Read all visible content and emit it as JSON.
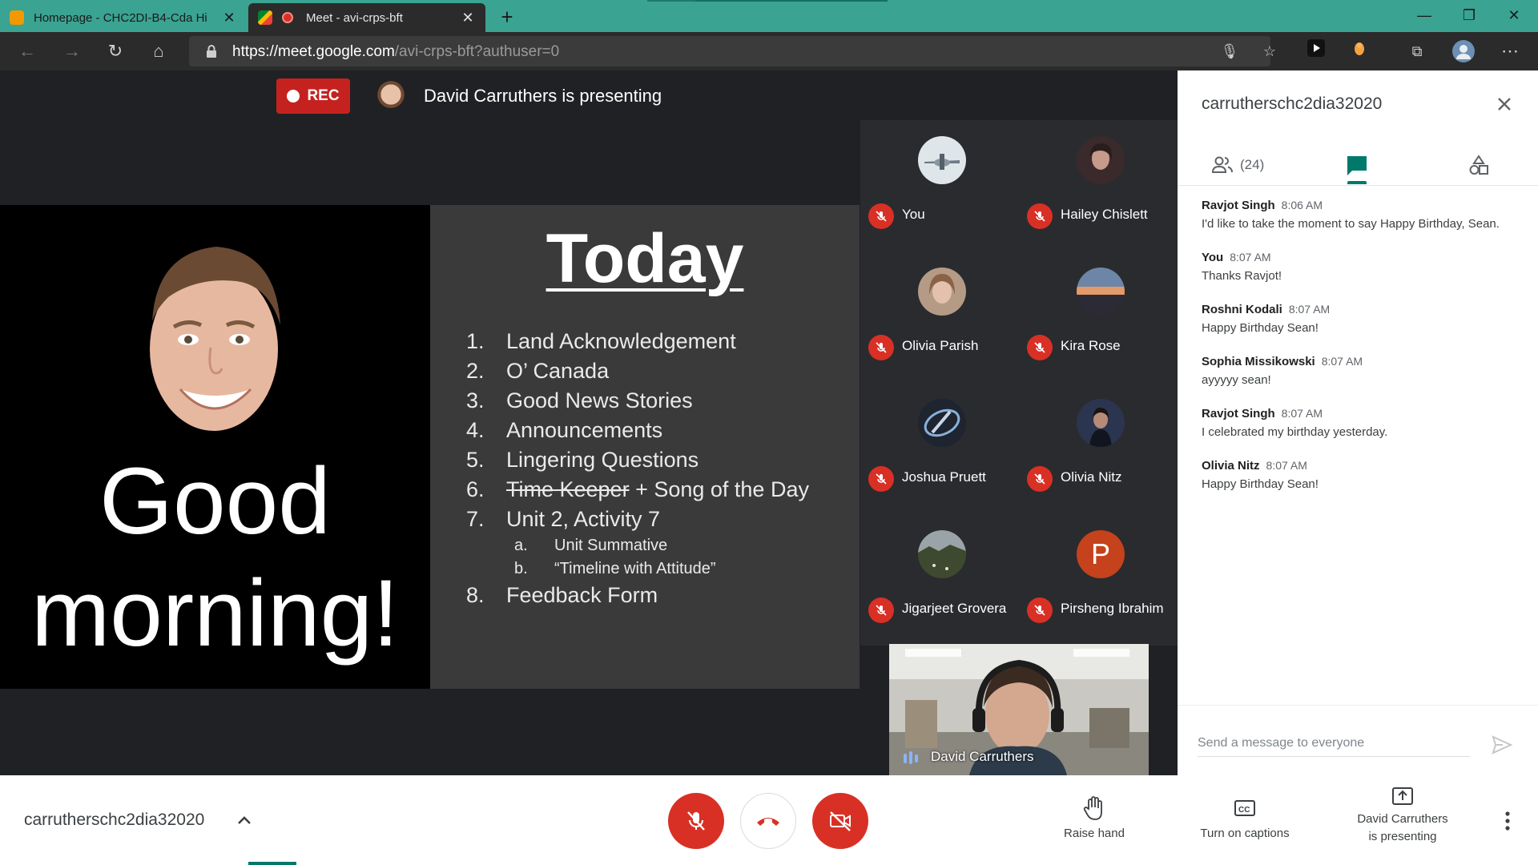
{
  "browser": {
    "tabs": [
      {
        "title": "Homepage - CHC2DI-B4-Cda Hi",
        "active": false
      },
      {
        "title": "Meet - avi-crps-bft",
        "active": true
      }
    ],
    "url_host": "https://meet.google.com",
    "url_path": "/avi-crps-bft?authuser=0"
  },
  "stage": {
    "rec_label": "REC",
    "presenting_text": "David Carruthers is presenting"
  },
  "slide": {
    "left_text": "Good morning!",
    "title": "Today",
    "agenda": [
      {
        "num": "1.",
        "text": "Land Acknowledgement"
      },
      {
        "num": "2.",
        "text": "O’ Canada"
      },
      {
        "num": "3.",
        "text": "Good News Stories"
      },
      {
        "num": "4.",
        "text": "Announcements"
      },
      {
        "num": "5.",
        "text": "Lingering Questions"
      },
      {
        "num": "6.",
        "struck": "Time Keeper",
        "text": " + Song of the Day"
      },
      {
        "num": "7.",
        "text": "Unit 2, Activity 7"
      },
      {
        "num": "a.",
        "text": "Unit Summative",
        "sub": true
      },
      {
        "num": "b.",
        "text": "“Timeline with Attitude”",
        "sub": true
      },
      {
        "num": "8.",
        "text": "Feedback Form"
      }
    ]
  },
  "participants": [
    {
      "name": "You",
      "avatar": "plane-photo"
    },
    {
      "name": "Hailey Chislett",
      "avatar": "portrait-photo"
    },
    {
      "name": "Olivia Parish",
      "avatar": "portrait-photo"
    },
    {
      "name": "Kira Rose",
      "avatar": "sunset-photo"
    },
    {
      "name": "Joshua Pruett",
      "avatar": "logo-photo"
    },
    {
      "name": "Olivia Nitz",
      "avatar": "portrait-photo"
    },
    {
      "name": "Jigarjeet Grovera",
      "avatar": "landscape-photo"
    },
    {
      "name": "Pirsheng Ibrahim",
      "avatar": "P"
    }
  ],
  "self_view": {
    "name": "David Carruthers"
  },
  "panel": {
    "title": "carrutherschc2dia32020",
    "people_count": "(24)",
    "messages": [
      {
        "sender": "Ravjot Singh",
        "time": "8:06 AM",
        "text": "I'd like to take the moment to say Happy Birthday, Sean."
      },
      {
        "sender": "You",
        "time": "8:07 AM",
        "text": "Thanks Ravjot!"
      },
      {
        "sender": "Roshni Kodali",
        "time": "8:07 AM",
        "text": "Happy Birthday Sean!"
      },
      {
        "sender": "Sophia Missikowski",
        "time": "8:07 AM",
        "text": "ayyyyy sean!"
      },
      {
        "sender": "Ravjot Singh",
        "time": "8:07 AM",
        "text": "I celebrated my birthday yesterday."
      },
      {
        "sender": "Olivia Nitz",
        "time": "8:07 AM",
        "text": "Happy Birthday Sean!"
      }
    ],
    "input_placeholder": "Send a message to everyone"
  },
  "bottom": {
    "meeting_code": "carrutherschc2dia32020",
    "raise_hand": "Raise hand",
    "captions": "Turn on captions",
    "presenting_line1": "David Carruthers",
    "presenting_line2": "is presenting"
  },
  "colors": {
    "accent": "#00796b",
    "danger": "#d93025",
    "tabbar": "#3aa392"
  }
}
